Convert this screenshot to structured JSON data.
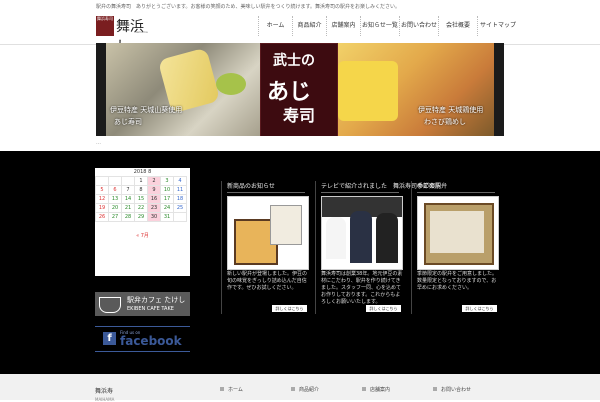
{
  "header": {
    "tagline": "駅弁の舞浜寿司　ありがとうございます。お客様の笑顔のため、美味しい駅弁をつくり続けます。舞浜寿司の駅弁をお楽しみください。",
    "logo_mark": "舞浜寿司",
    "logo_script": "舞浜し",
    "logo_sub": "Maihama"
  },
  "nav": [
    {
      "label": "ホーム"
    },
    {
      "label": "商品紹介"
    },
    {
      "label": "店舗案内"
    },
    {
      "label": "お知らせ一覧"
    },
    {
      "label": "お問い合わせ"
    },
    {
      "label": "会社概要"
    },
    {
      "label": "サイトマップ"
    }
  ],
  "hero": {
    "left_caption_1": "伊豆特産 天城山葵使用",
    "left_caption_2": "あじ寿司",
    "center_big": "武士の",
    "center_mid": "あじ",
    "center_small": "寿司",
    "right_caption_1": "伊豆特産 天城鶏使用",
    "right_caption_2": "わさび鶏めし"
  },
  "strip_text": "…",
  "calendar": {
    "caption": "2018 8",
    "rows": [
      [
        "",
        "",
        "",
        "1",
        "2",
        "3",
        "4"
      ],
      [
        "5",
        "6",
        "7",
        "8",
        "9",
        "10",
        "11"
      ],
      [
        "12",
        "13",
        "14",
        "15",
        "16",
        "17",
        "18"
      ],
      [
        "19",
        "20",
        "21",
        "22",
        "23",
        "24",
        "25"
      ],
      [
        "26",
        "27",
        "28",
        "29",
        "30",
        "31",
        ""
      ]
    ],
    "nav": "« 7月"
  },
  "banners": {
    "cafe_top": "駅弁カフェ たけし",
    "cafe_bottom": "EKIBEN CAFE TAKE",
    "fb_small": "Find us on",
    "fb_big": "facebook"
  },
  "cards": [
    {
      "title": "新商品のお知らせ",
      "body": "新しい駅弁が登場しました。伊豆の旬の味覚をぎっしり詰め込んだ自信作です。ぜひお試しください。",
      "more": "詳しくはこちら"
    },
    {
      "title": "テレビで紹介されました　舞浜寿司のご案内",
      "body": "舞浜寿司は創業38年。地元伊豆の素材にこだわり、駅弁を作り続けてきました。スタッフ一同、心を込めてお作りしております。これからもよろしくお願いいたします。",
      "more": "詳しくはこちら"
    },
    {
      "title": "季節の駅弁",
      "body": "季節限定の駅弁をご用意しました。数量限定となっておりますので、お早めにお求めください。",
      "more": "詳しくはこちら"
    }
  ],
  "footer": {
    "heading": "舞浜寿",
    "sub": "MAIHAMA",
    "links": [
      "ホーム",
      "商品紹介",
      "店舗案内",
      "お問い合わせ"
    ]
  }
}
